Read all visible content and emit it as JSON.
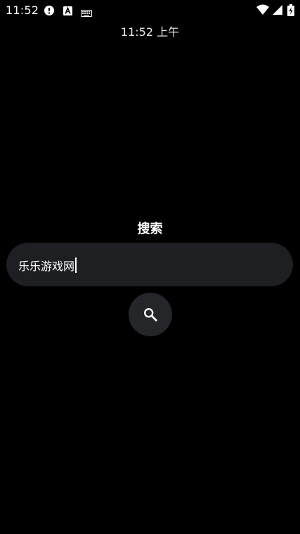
{
  "status_bar": {
    "time": "11:52",
    "notification_icons": [
      "alert-icon",
      "font-a-icon",
      "keyboard-icon"
    ],
    "system_icons": [
      "wifi-icon",
      "cell-signal-icon",
      "battery-charging-icon"
    ]
  },
  "header": {
    "clock": "11:52 上午"
  },
  "search": {
    "title": "搜索",
    "input_value": "乐乐游戏网",
    "button_icon": "search-icon"
  },
  "colors": {
    "background": "#000000",
    "input_background": "#1e1f23",
    "button_background": "#25262a",
    "text": "#ffffff"
  }
}
